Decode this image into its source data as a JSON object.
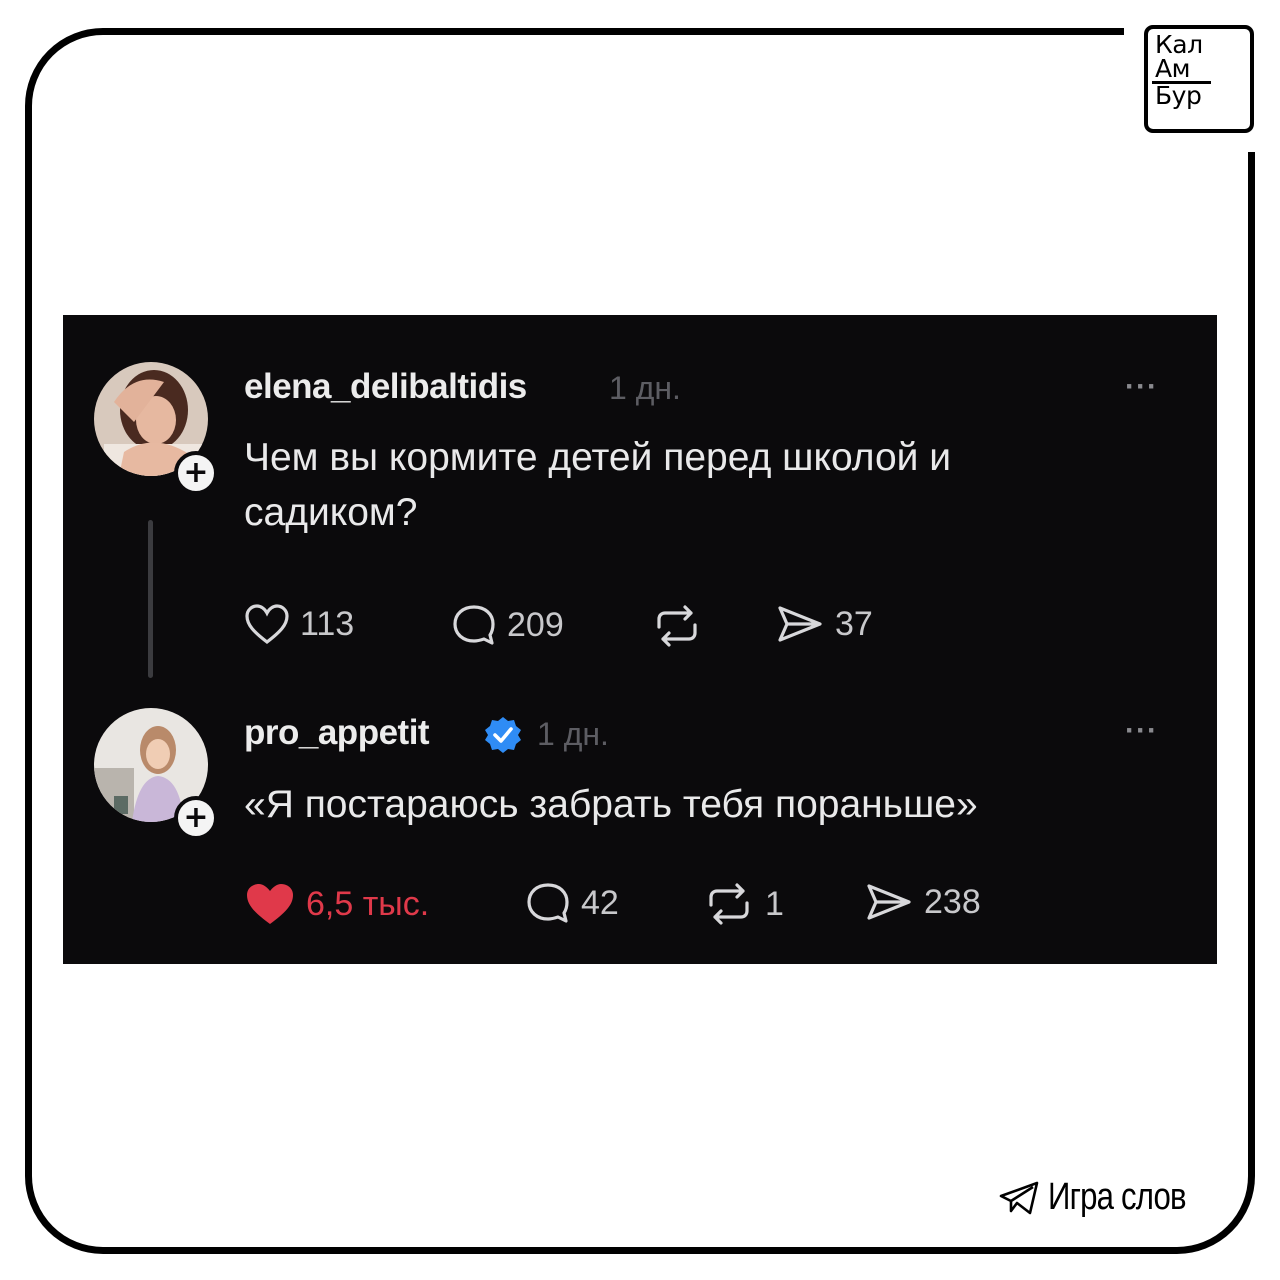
{
  "brand": {
    "logo_lines": [
      "Кал",
      "Ам",
      "Бур"
    ]
  },
  "posts": [
    {
      "username": "elena_delibaltidis",
      "time": "1 дн.",
      "text": "Чем вы кормите детей перед школой и садиком?",
      "likes": "113",
      "comments": "209",
      "reposts": "",
      "shares": "37",
      "liked": false,
      "verified": false
    },
    {
      "username": "pro_appetit",
      "time": "1 дн.",
      "text": "«Я постараюсь забрать тебя пораньше»",
      "likes": "6,5 тыс.",
      "comments": "42",
      "reposts": "1",
      "shares": "238",
      "liked": true,
      "verified": true
    }
  ],
  "icons": {
    "like": "heart-icon",
    "comment": "comment-bubble-icon",
    "repost": "repost-icon",
    "share": "send-icon",
    "more": "more-dots-icon",
    "footer": "telegram-plane-icon"
  },
  "more_label": "···",
  "follow_label": "+",
  "footer": {
    "label": "Игра слов"
  },
  "colors": {
    "card_bg": "#0b0a0c",
    "text": "#e9e9ea",
    "muted": "#5d5d63",
    "like_red": "#e0394a",
    "verified_blue": "#2f8cf5"
  }
}
